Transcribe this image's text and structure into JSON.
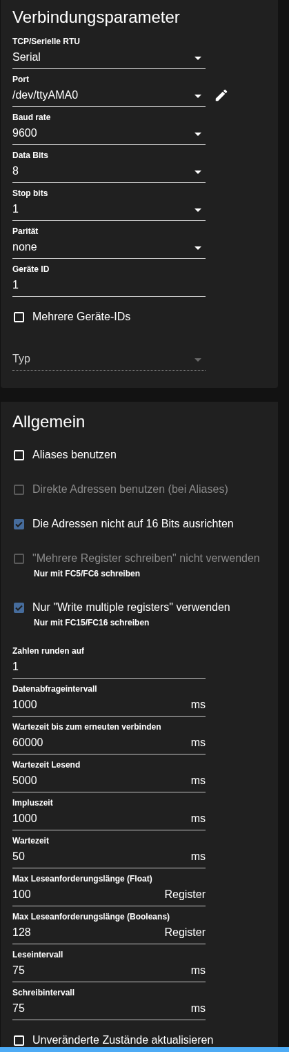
{
  "connection": {
    "title": "Verbindungsparameter",
    "items": [
      {
        "kind": "select",
        "label": "TCP/Serielle RTU",
        "value": "Serial"
      },
      {
        "kind": "select",
        "label": "Port",
        "value": "/dev/ttyAMA0",
        "editable": true
      },
      {
        "kind": "select",
        "label": "Baud rate",
        "value": "9600"
      },
      {
        "kind": "select",
        "label": "Data Bits",
        "value": "8"
      },
      {
        "kind": "select",
        "label": "Stop bits",
        "value": "1"
      },
      {
        "kind": "select",
        "label": "Parität",
        "value": "none"
      },
      {
        "kind": "text",
        "label": "Geräte ID",
        "value": "1"
      },
      {
        "kind": "checkbox",
        "label": "Mehrere Geräte-IDs",
        "checked": false,
        "disabled": false
      },
      {
        "kind": "select",
        "placeholder": "Typ",
        "disabled": true
      }
    ]
  },
  "general": {
    "title": "Allgemein",
    "items": [
      {
        "kind": "checkbox",
        "label": "Aliases benutzen",
        "checked": false,
        "disabled": false
      },
      {
        "kind": "checkbox",
        "label": "Direkte Adressen benutzen (bei Aliases)",
        "checked": false,
        "disabled": true
      },
      {
        "kind": "checkbox",
        "label": "Die Adressen nicht auf 16 Bits ausrichten",
        "checked": true,
        "disabled": false
      },
      {
        "kind": "checkbox",
        "label": "\"Mehrere Register schreiben\" nicht verwenden",
        "checked": false,
        "disabled": true,
        "helper": "Nur mit FC5/FC6 schreiben"
      },
      {
        "kind": "checkbox",
        "label": "Nur \"Write multiple registers\" verwenden",
        "checked": true,
        "disabled": false,
        "helper": "Nur mit FC15/FC16 schreiben"
      },
      {
        "kind": "text",
        "label": "Zahlen runden auf",
        "value": "1"
      },
      {
        "kind": "text",
        "label": "Datenabfrageintervall",
        "value": "1000",
        "unit": "ms"
      },
      {
        "kind": "text",
        "label": "Wartezeit bis zum erneuten verbinden",
        "value": "60000",
        "unit": "ms"
      },
      {
        "kind": "text",
        "label": "Wartezeit Lesend",
        "value": "5000",
        "unit": "ms"
      },
      {
        "kind": "text",
        "label": "Impluszeit",
        "value": "1000",
        "unit": "ms"
      },
      {
        "kind": "text",
        "label": "Wartezeit",
        "value": "50",
        "unit": "ms"
      },
      {
        "kind": "text",
        "label": "Max Leseanforderungslänge (Float)",
        "value": "100",
        "unit": "Register"
      },
      {
        "kind": "text",
        "label": "Max Leseanforderungslänge (Booleans)",
        "value": "128",
        "unit": "Register"
      },
      {
        "kind": "text",
        "label": "Leseintervall",
        "value": "75",
        "unit": "ms"
      },
      {
        "kind": "text",
        "label": "Schreibintervall",
        "value": "75",
        "unit": "ms"
      },
      {
        "kind": "checkbox",
        "label": "Unveränderte Zustände aktualisieren",
        "checked": false,
        "disabled": false
      }
    ]
  }
}
